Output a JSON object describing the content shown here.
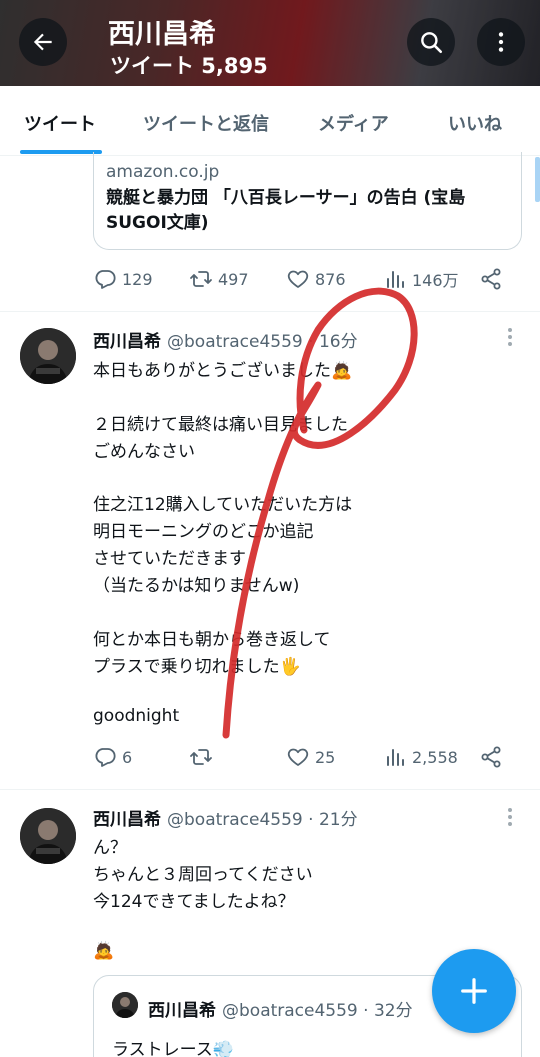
{
  "header": {
    "title": "西川昌希",
    "subtitle": "ツイート 5,895",
    "back_icon": "arrow-left-icon",
    "search_icon": "search-icon",
    "more_icon": "more-vertical-icon"
  },
  "tabs": [
    {
      "label": "ツイート",
      "active": true
    },
    {
      "label": "ツイートと返信",
      "active": false
    },
    {
      "label": "メディア",
      "active": false
    },
    {
      "label": "いいね",
      "active": false
    }
  ],
  "link_card": {
    "domain": "amazon.co.jp",
    "title_line1": "競艇と暴力団 「八百長レーサー」の告白 (宝島",
    "title_line2": "SUGOI文庫)"
  },
  "tweet0_actions": {
    "replies": "129",
    "retweets": "497",
    "likes": "876",
    "views": "146万"
  },
  "tweet1": {
    "name": "西川昌希",
    "handle": "@boatrace4559 · 16分",
    "lines": [
      "本日もありがとうございました🙇",
      "",
      "２日続けて最終は痛い目見ました",
      "ごめんなさい",
      "",
      "住之江12購入していただいた方は",
      "明日モーニングのどこか追記",
      "させていただきます",
      "（当たるかは知りませんw)",
      "",
      "何とか本日も朝から巻き返して",
      "プラスで乗り切れました🖐",
      "",
      "goodnight"
    ],
    "actions": {
      "replies": "6",
      "retweets": "",
      "likes": "25",
      "views": "2,558"
    }
  },
  "tweet2": {
    "name": "西川昌希",
    "handle": "@boatrace4559 · 21分",
    "lines": [
      "ん？",
      "ちゃんと３周回ってください",
      "今124できてましたよね？",
      "",
      "🙇"
    ],
    "quote": {
      "name": "西川昌希",
      "handle": "@boatrace4559 · 32分",
      "text": "ラストレース💨"
    }
  },
  "colors": {
    "accent": "#1d9bf0",
    "text_primary": "#0f1419",
    "text_secondary": "#536471",
    "annotation_red": "#d42a2a"
  }
}
